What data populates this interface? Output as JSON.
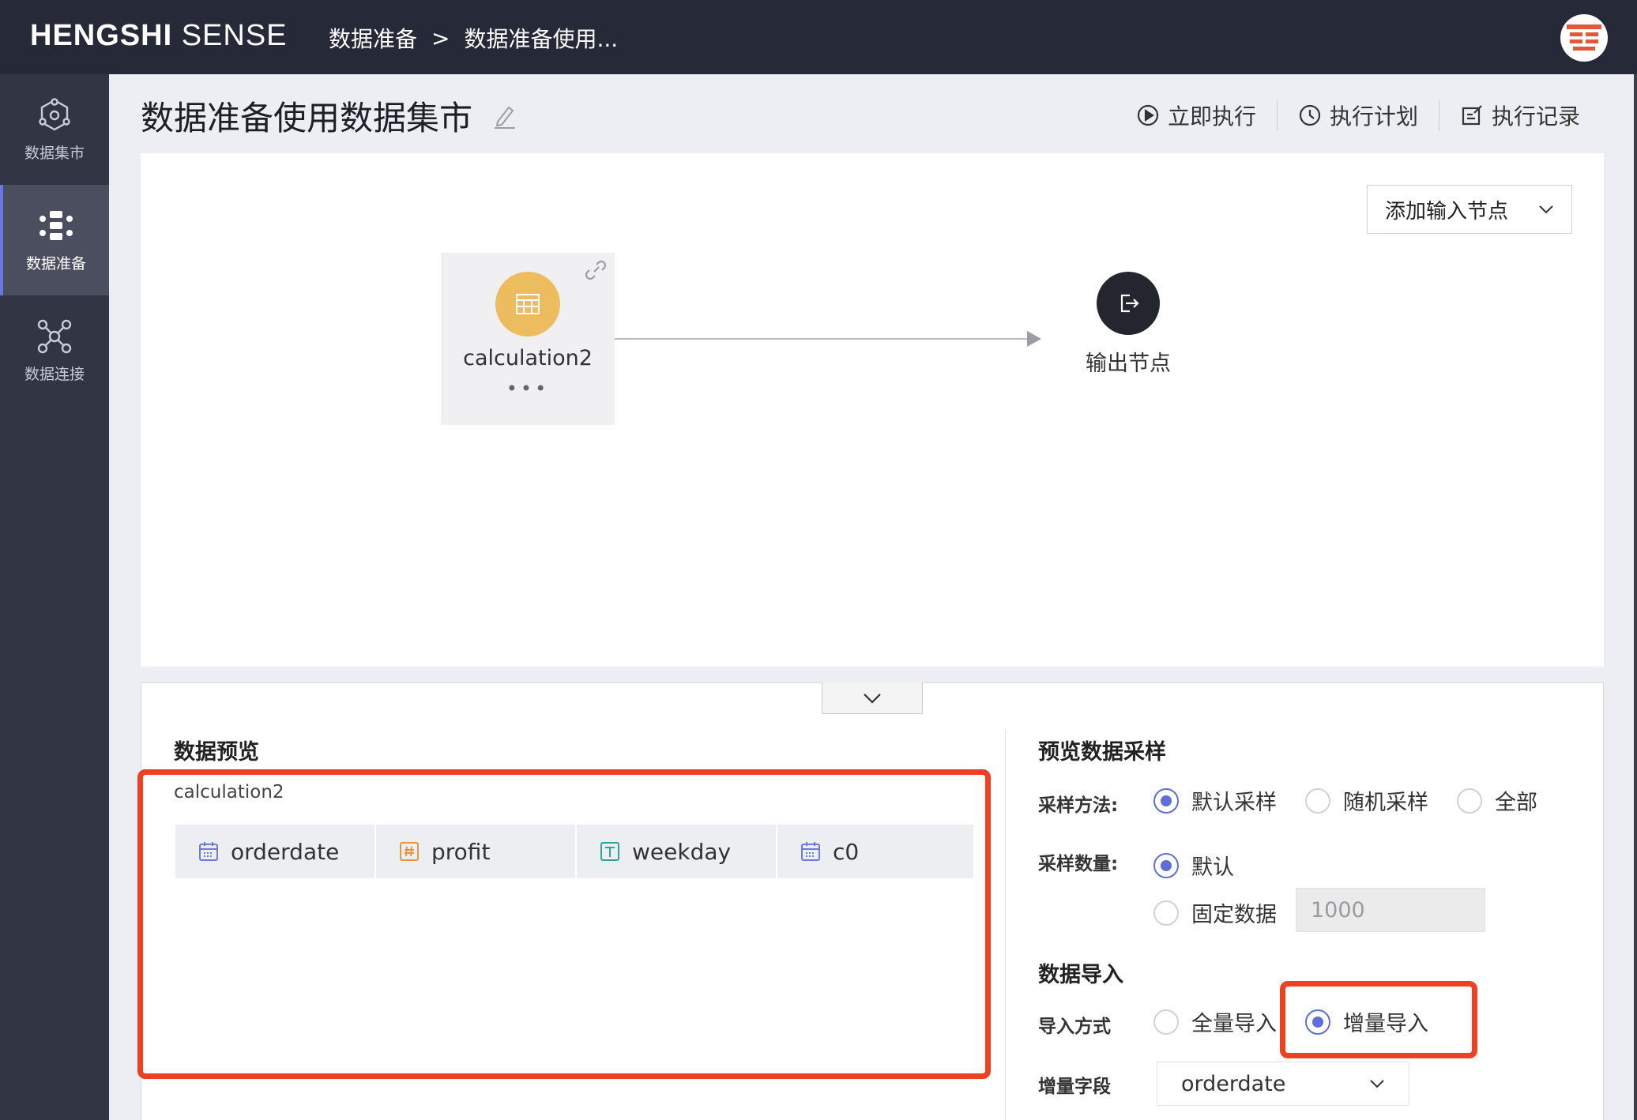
{
  "header": {
    "brand_bold": "HENGSHI",
    "brand_light": "SENSE",
    "breadcrumb": [
      "数据准备",
      ">",
      "数据准备使用..."
    ]
  },
  "sidebar": {
    "items": [
      {
        "label": "数据集市",
        "icon": "data-mart-icon",
        "active": false
      },
      {
        "label": "数据准备",
        "icon": "data-prep-icon",
        "active": true
      },
      {
        "label": "数据连接",
        "icon": "data-connect-icon",
        "active": false
      }
    ]
  },
  "page": {
    "title": "数据准备使用数据集市",
    "actions": [
      {
        "label": "立即执行",
        "icon": "play-circle-icon"
      },
      {
        "label": "执行计划",
        "icon": "clock-icon"
      },
      {
        "label": "执行记录",
        "icon": "edit-record-icon"
      }
    ]
  },
  "canvas": {
    "add_input_label": "添加输入节点",
    "input_node": {
      "label": "calculation2",
      "dots": "•••"
    },
    "output_node": {
      "label": "输出节点"
    }
  },
  "preview": {
    "title": "数据预览",
    "subtitle": "calculation2",
    "columns": [
      {
        "name": "orderdate",
        "type_icon": "calendar-icon",
        "color": "#6b7bd9"
      },
      {
        "name": "profit",
        "type_icon": "hash-icon",
        "color": "#e8963a"
      },
      {
        "name": "weekday",
        "type_icon": "text-icon",
        "color": "#2ea39a"
      },
      {
        "name": "c0",
        "type_icon": "calendar-icon",
        "color": "#6b7bd9"
      }
    ]
  },
  "sampling": {
    "title": "预览数据采样",
    "method_label": "采样方法:",
    "method_options": [
      {
        "label": "默认采样",
        "selected": true
      },
      {
        "label": "随机采样",
        "selected": false
      },
      {
        "label": "全部",
        "selected": false
      }
    ],
    "count_label": "采样数量:",
    "count_options": [
      {
        "label": "默认",
        "selected": true
      },
      {
        "label": "固定数据",
        "selected": false
      }
    ],
    "fixed_value": "1000"
  },
  "import": {
    "title": "数据导入",
    "mode_label": "导入方式",
    "mode_options": [
      {
        "label": "全量导入",
        "selected": false
      },
      {
        "label": "增量导入",
        "selected": true
      }
    ],
    "field_label": "增量字段",
    "field_value": "orderdate"
  },
  "colors": {
    "highlight": "#ee4022",
    "accent": "#5f6ed8",
    "node_input": "#ecbc5e",
    "node_output": "#23262f"
  }
}
